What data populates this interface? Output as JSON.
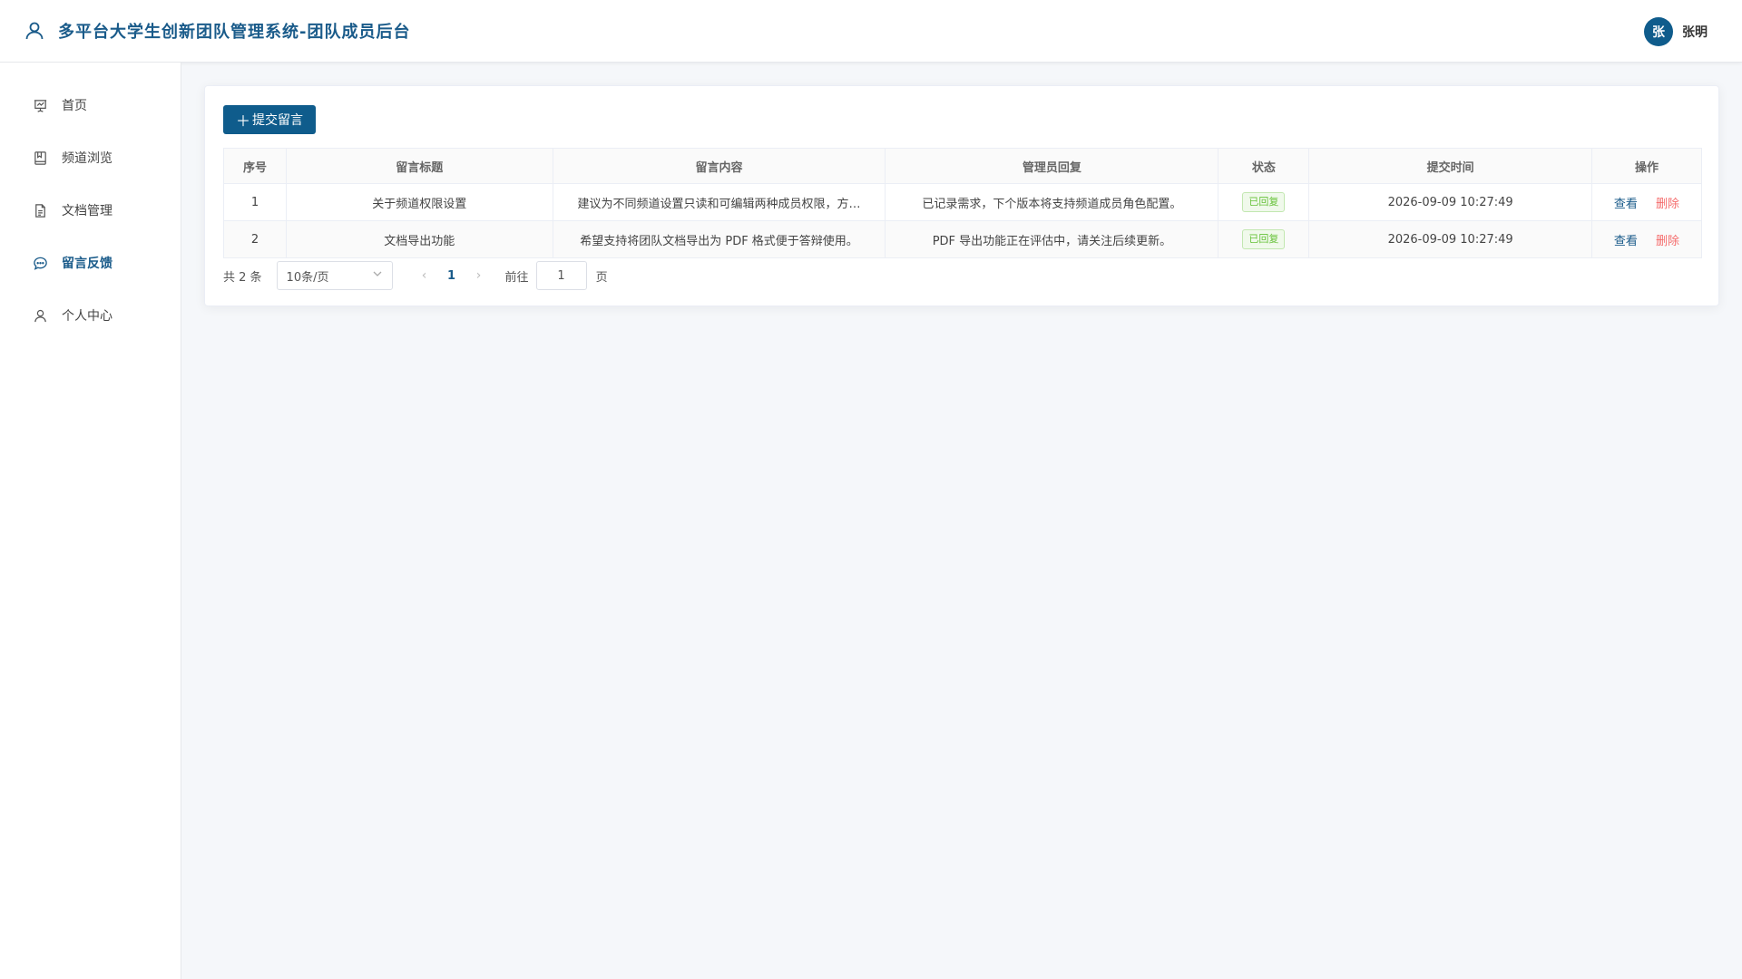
{
  "header": {
    "title": "多平台大学生创新团队管理系统-团队成员后台",
    "user_initial": "张",
    "user_name": "张明"
  },
  "sidebar": {
    "items": [
      {
        "label": "首页",
        "icon": "presentation-icon"
      },
      {
        "label": "频道浏览",
        "icon": "book-icon"
      },
      {
        "label": "文档管理",
        "icon": "document-icon"
      },
      {
        "label": "留言反馈",
        "icon": "chat-icon",
        "active": true
      },
      {
        "label": "个人中心",
        "icon": "user-icon"
      }
    ]
  },
  "toolbar": {
    "submit_label": "提交留言"
  },
  "table": {
    "columns": [
      "序号",
      "留言标题",
      "留言内容",
      "管理员回复",
      "状态",
      "提交时间",
      "操作"
    ],
    "rows": [
      {
        "index": "1",
        "title": "关于频道权限设置",
        "content": "建议为不同频道设置只读和可编辑两种成员权限，方…",
        "reply": "已记录需求，下个版本将支持频道成员角色配置。",
        "status": "已回复",
        "time": "2026-09-09 10:27:49",
        "view": "查看",
        "delete": "删除"
      },
      {
        "index": "2",
        "title": "文档导出功能",
        "content": "希望支持将团队文档导出为 PDF 格式便于答辩使用。",
        "reply": "PDF 导出功能正在评估中，请关注后续更新。",
        "status": "已回复",
        "time": "2026-09-09 10:27:49",
        "view": "查看",
        "delete": "删除"
      }
    ]
  },
  "pagination": {
    "total": "共 2 条",
    "page_size": "10条/页",
    "current_page": "1",
    "goto_label": "前往",
    "goto_value": "1",
    "goto_suffix": "页"
  },
  "colors": {
    "primary": "#0f5c8c",
    "success": "#67c23a",
    "danger": "#f56c6c"
  }
}
